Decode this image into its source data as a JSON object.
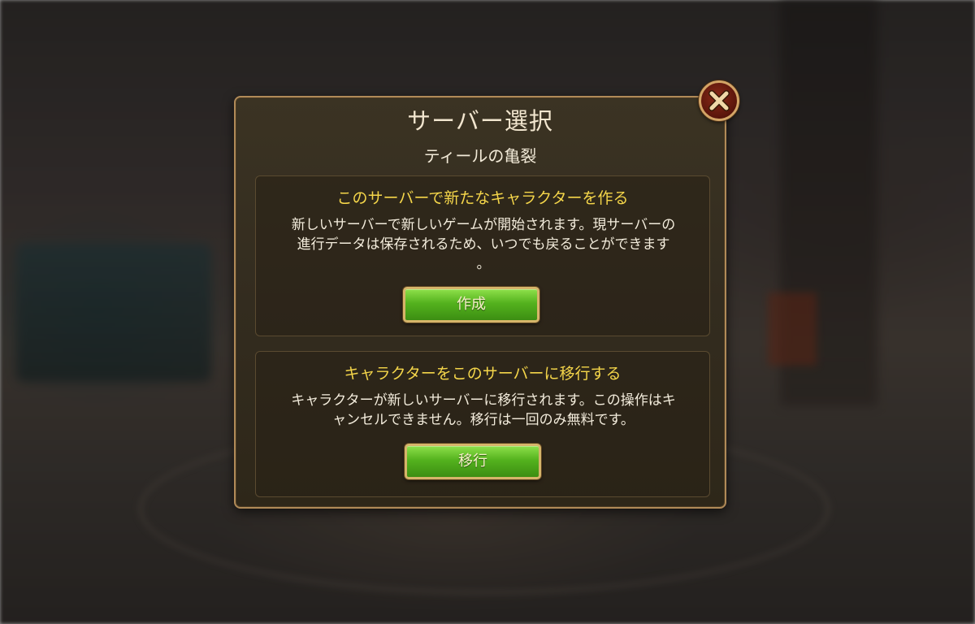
{
  "dialog": {
    "title": "サーバー選択",
    "server_name": "ティールの亀裂",
    "close_icon": "close-icon"
  },
  "create_section": {
    "heading": "このサーバーで新たなキャラクターを作る",
    "description_line1": "新しいサーバーで新しいゲームが開始されます。現サーバーの",
    "description_line2": "進行データは保存されるため、いつでも戻ることができます",
    "description_line3": "。",
    "button_label": "作成"
  },
  "migrate_section": {
    "heading": "キャラクターをこのサーバーに移行する",
    "description_line1": "キャラクターが新しいサーバーに移行されます。この操作はキ",
    "description_line2": "ャンセルできません。移行は一回のみ無料です。",
    "button_label": "移行"
  },
  "colors": {
    "heading_yellow": "#f5d64a",
    "button_green": "#54b21e",
    "frame_gold": "#b08a58",
    "close_red": "#5c160c"
  }
}
